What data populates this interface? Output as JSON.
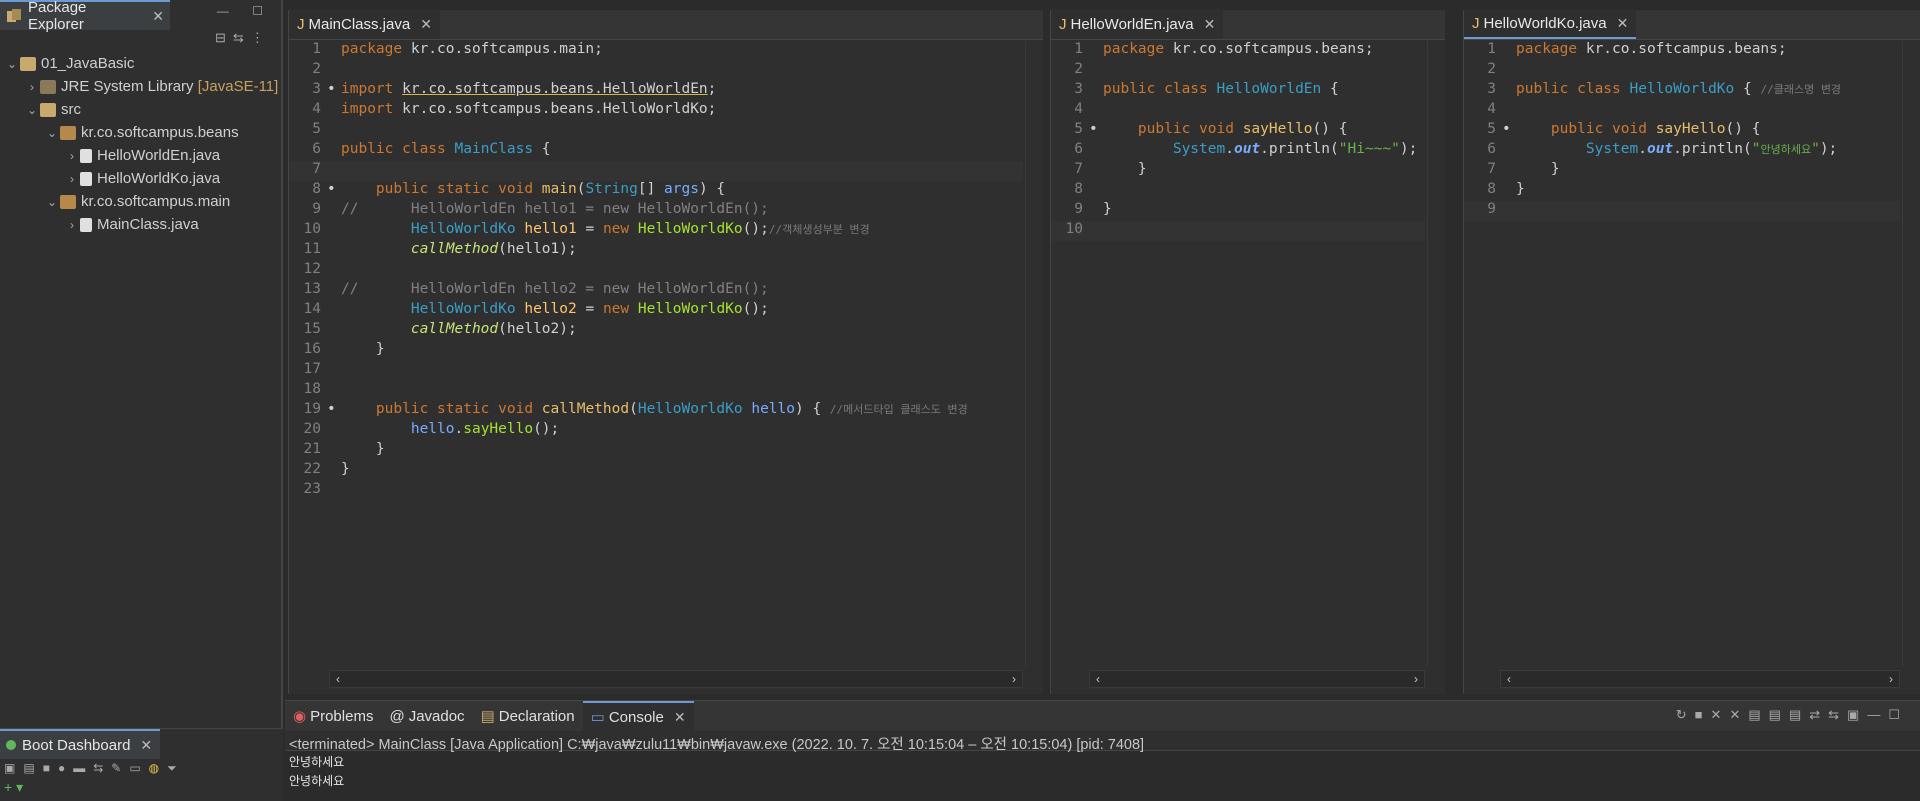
{
  "package_explorer": {
    "title": "Package Explorer",
    "tree": [
      {
        "label": "01_JavaBasic",
        "indent": 0,
        "expanded": true,
        "icon": "project-icon"
      },
      {
        "label": "JRE System Library",
        "suffix": "[JavaSE-11]",
        "indent": 1,
        "expanded": false,
        "icon": "library-icon"
      },
      {
        "label": "src",
        "indent": 1,
        "expanded": true,
        "icon": "folder-icon"
      },
      {
        "label": "kr.co.softcampus.beans",
        "indent": 2,
        "expanded": true,
        "icon": "package-icon"
      },
      {
        "label": "HelloWorldEn.java",
        "indent": 3,
        "expanded": false,
        "icon": "java-file-icon"
      },
      {
        "label": "HelloWorldKo.java",
        "indent": 3,
        "expanded": false,
        "icon": "java-file-icon"
      },
      {
        "label": "kr.co.softcampus.main",
        "indent": 2,
        "expanded": true,
        "icon": "package-icon"
      },
      {
        "label": "MainClass.java",
        "indent": 3,
        "expanded": false,
        "icon": "java-file-icon"
      }
    ]
  },
  "boot_dashboard": {
    "title": "Boot Dashboard"
  },
  "editors": [
    {
      "tab": "MainClass.java",
      "selected": false
    },
    {
      "tab": "HelloWorldEn.java",
      "selected": false
    },
    {
      "tab": "HelloWorldKo.java",
      "selected": true
    }
  ],
  "console": {
    "tabs": [
      "Problems",
      "Javadoc",
      "Declaration",
      "Console"
    ],
    "active_tab": "Console",
    "info": "<terminated> MainClass [Java Application] C:₩java₩zulu11₩bin₩javaw.exe  (2022. 10. 7. 오전 10:15:04 – 오전 10:15:04) [pid: 7408]",
    "output": [
      "안녕하세요",
      "안녕하세요"
    ]
  },
  "colors": {
    "accent": "#6b9bd1",
    "keyword": "#cc7832",
    "class": "#3b9ec7",
    "string": "#6ab04c"
  }
}
